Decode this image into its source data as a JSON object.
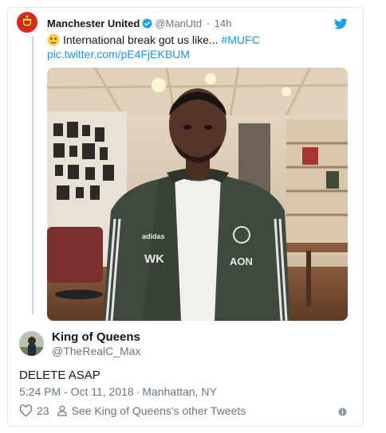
{
  "quoted_tweet": {
    "author_name": "Manchester United",
    "author_handle": "@ManUtd",
    "separator": "·",
    "time": "14h",
    "text_main": "International break got us like...",
    "hashtag": "#MUFC",
    "link": "pic.twitter.com/pE4FjEKBUM",
    "jacket_text_brand": "adidas",
    "jacket_text_logo": "WK",
    "jacket_text_sponsor": "AON"
  },
  "reply_tweet": {
    "author_name": "King of Queens",
    "author_handle": "@TheRealC_Max",
    "text": "DELETE ASAP",
    "time": "5:24 PM - Oct 11, 2018",
    "location_separator": "·",
    "location": "Manhattan, NY",
    "likes": "23",
    "profile_link": "See King of Queens's other Tweets"
  },
  "colors": {
    "link": "#1b95e0",
    "secondary_text": "#657786",
    "border": "#e1e8ed",
    "brand_red": "#da291c"
  },
  "icons": [
    "verified-badge-icon",
    "twitter-bird-icon",
    "neutral-face-emoji-icon",
    "heart-icon",
    "person-icon",
    "info-icon"
  ]
}
